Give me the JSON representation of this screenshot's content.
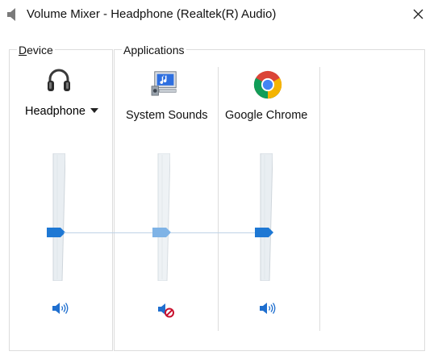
{
  "window": {
    "title": "Volume Mixer - Headphone (Realtek(R) Audio)",
    "close_glyph": "✕"
  },
  "device": {
    "section_label_underlined": "D",
    "section_label_rest": "evice",
    "name": "Headphone",
    "icon": "headphones-icon",
    "mute_icon": "speaker-icon",
    "volume_fraction": 0.62,
    "muted": false
  },
  "applications": {
    "section_label": "Applications",
    "items": [
      {
        "name": "System Sounds",
        "icon": "system-sounds-icon",
        "mute_icon": "speaker-muted-icon",
        "volume_fraction": 0.62,
        "muted": true
      },
      {
        "name": "Google Chrome",
        "icon": "chrome-icon",
        "mute_icon": "speaker-icon",
        "volume_fraction": 0.62,
        "muted": false
      }
    ]
  },
  "colors": {
    "thumb_active": "#1e78d4",
    "thumb_muted": "#7fb3e6",
    "speaker": "#1f6fcf",
    "mute_badge": "#c8102e"
  }
}
